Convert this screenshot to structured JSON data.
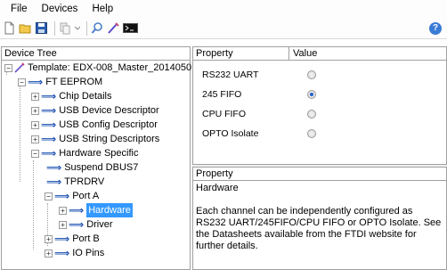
{
  "menu": [
    "File",
    "Devices",
    "Help"
  ],
  "toolbar": {
    "icons": [
      "new-document-icon",
      "open-folder-icon",
      "save-icon",
      "copy-icon",
      "search-icon",
      "program-icon",
      "console-icon",
      "help-icon"
    ]
  },
  "tree": {
    "header": "Device Tree",
    "items": [
      {
        "label": "Template: EDX-008_Master_2014050"
      },
      {
        "label": "FT EEPROM"
      },
      {
        "label": "Chip Details"
      },
      {
        "label": "USB Device Descriptor"
      },
      {
        "label": "USB Config Descriptor"
      },
      {
        "label": "USB String Descriptors"
      },
      {
        "label": "Hardware Specific"
      },
      {
        "label": "Suspend DBUS7"
      },
      {
        "label": "TPRDRV"
      },
      {
        "label": "Port A"
      },
      {
        "label": "Hardware"
      },
      {
        "label": "Driver"
      },
      {
        "label": "Port B"
      },
      {
        "label": "IO Pins"
      }
    ]
  },
  "properties": {
    "col_property": "Property",
    "col_value": "Value",
    "rows": [
      {
        "name": "RS232 UART",
        "selected": false
      },
      {
        "name": "245 FIFO",
        "selected": true
      },
      {
        "name": "CPU FIFO",
        "selected": false
      },
      {
        "name": "OPTO Isolate",
        "selected": false
      }
    ]
  },
  "description": {
    "header": "Property",
    "title": "Hardware",
    "text": "Each channel can be independently configured as RS232 UART/245FIFO/CPU FIFO or OPTO Isolate.  See the Datasheets available from the FTDI website for further details."
  },
  "colors": {
    "selection": "#3399ff",
    "arrow": "#1a4fb0",
    "radio_dot": "#1f5fd1"
  }
}
